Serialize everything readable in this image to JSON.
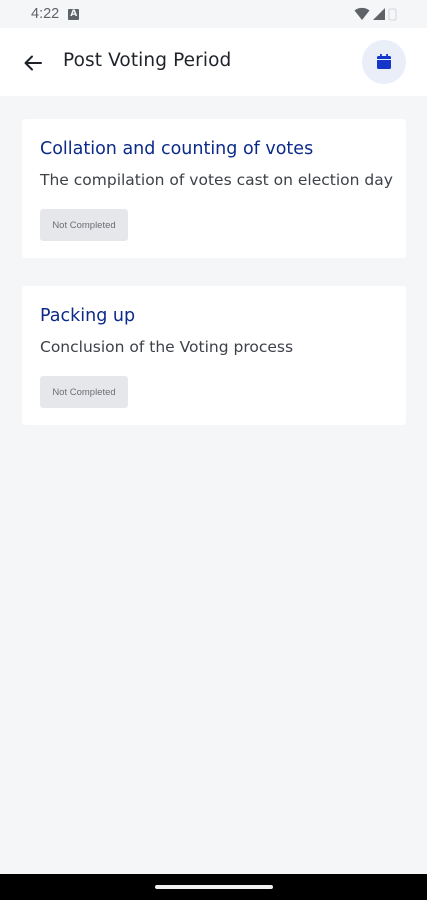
{
  "status_bar": {
    "time": "4:22",
    "notification_glyph": "A"
  },
  "app_bar": {
    "title": "Post Voting Period",
    "back_icon": "arrow-left-icon",
    "action_icon": "calendar-icon"
  },
  "cards": [
    {
      "title": "Collation and counting of votes",
      "description": "The compilation of votes cast on election day",
      "status": "Not Completed"
    },
    {
      "title": "Packing up",
      "description": "Conclusion of the Voting process",
      "status": "Not Completed"
    }
  ],
  "colors": {
    "accent": "#0c2a8a",
    "calendar_icon": "#1536c9",
    "background": "#f5f6f8"
  }
}
